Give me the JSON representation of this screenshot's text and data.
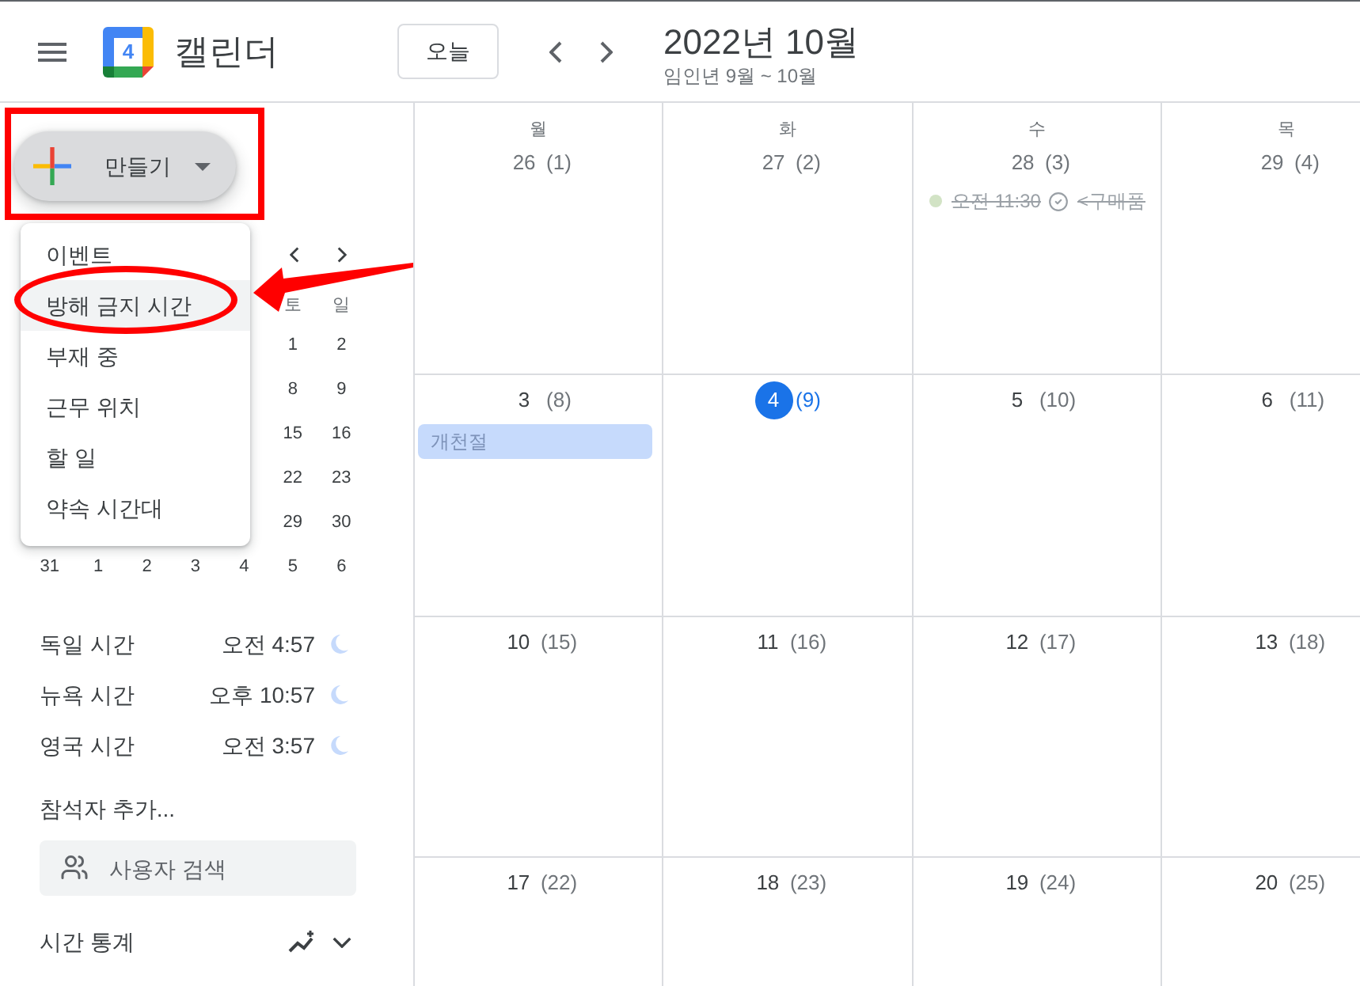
{
  "header": {
    "logo_text": "4",
    "app_name": "캘린더",
    "today_button": "오늘",
    "title": "2022년 10월",
    "subtitle": "임인년 9월 ~ 10월"
  },
  "create_button": {
    "label": "만들기"
  },
  "create_menu": {
    "items": [
      {
        "label": "이벤트",
        "selected": false
      },
      {
        "label": "방해 금지 시간",
        "selected": true
      },
      {
        "label": "부재 중",
        "selected": false
      },
      {
        "label": "근무 위치",
        "selected": false
      },
      {
        "label": "할 일",
        "selected": false
      },
      {
        "label": "약속 시간대",
        "selected": false
      }
    ]
  },
  "mini_calendar": {
    "weekday_headers": [
      "토",
      "일"
    ],
    "weeks": [
      [
        "1",
        "2"
      ],
      [
        "8",
        "9"
      ],
      [
        "15",
        "16"
      ],
      [
        "22",
        "23"
      ],
      [
        "29",
        "30"
      ],
      [
        "31",
        "1",
        "2",
        "3",
        "4",
        "5",
        "6"
      ]
    ]
  },
  "world_clocks": [
    {
      "label": "독일 시간",
      "time": "오전 4:57"
    },
    {
      "label": "뉴욕 시간",
      "time": "오후 10:57"
    },
    {
      "label": "영국 시간",
      "time": "오전 3:57"
    }
  ],
  "add_attendees": {
    "label": "참석자 추가..."
  },
  "people_search": {
    "placeholder": "사용자 검색"
  },
  "time_insights": {
    "label": "시간 통계"
  },
  "calendar": {
    "weekdays": [
      "월",
      "화",
      "수",
      "목"
    ],
    "weeks": [
      {
        "days": [
          {
            "date": "26",
            "week_number": "(1)",
            "other_month": true,
            "today": false
          },
          {
            "date": "27",
            "week_number": "(2)",
            "other_month": true,
            "today": false
          },
          {
            "date": "28",
            "week_number": "(3)",
            "other_month": true,
            "today": false,
            "events": [
              {
                "kind": "task",
                "time": "오전 11:30",
                "title": "<구매품",
                "completed": true,
                "color": "#d2e3c5"
              }
            ]
          },
          {
            "date": "29",
            "week_number": "(4)",
            "other_month": true,
            "today": false
          }
        ]
      },
      {
        "days": [
          {
            "date": "3",
            "week_number": "(8)",
            "other_month": false,
            "today": false,
            "events": [
              {
                "kind": "all_day",
                "title": "개천절",
                "color": "#c6dafc",
                "past": true
              }
            ]
          },
          {
            "date": "4",
            "week_number": "(9)",
            "other_month": false,
            "today": true
          },
          {
            "date": "5",
            "week_number": "(10)",
            "other_month": false,
            "today": false
          },
          {
            "date": "6",
            "week_number": "(11)",
            "other_month": false,
            "today": false
          }
        ]
      },
      {
        "days": [
          {
            "date": "10",
            "week_number": "(15)",
            "other_month": false,
            "today": false
          },
          {
            "date": "11",
            "week_number": "(16)",
            "other_month": false,
            "today": false
          },
          {
            "date": "12",
            "week_number": "(17)",
            "other_month": false,
            "today": false
          },
          {
            "date": "13",
            "week_number": "(18)",
            "other_month": false,
            "today": false
          }
        ]
      },
      {
        "days": [
          {
            "date": "17",
            "week_number": "(22)",
            "other_month": false,
            "today": false
          },
          {
            "date": "18",
            "week_number": "(23)",
            "other_month": false,
            "today": false
          },
          {
            "date": "19",
            "week_number": "(24)",
            "other_month": false,
            "today": false
          },
          {
            "date": "20",
            "week_number": "(25)",
            "other_month": false,
            "today": false
          }
        ]
      }
    ]
  }
}
